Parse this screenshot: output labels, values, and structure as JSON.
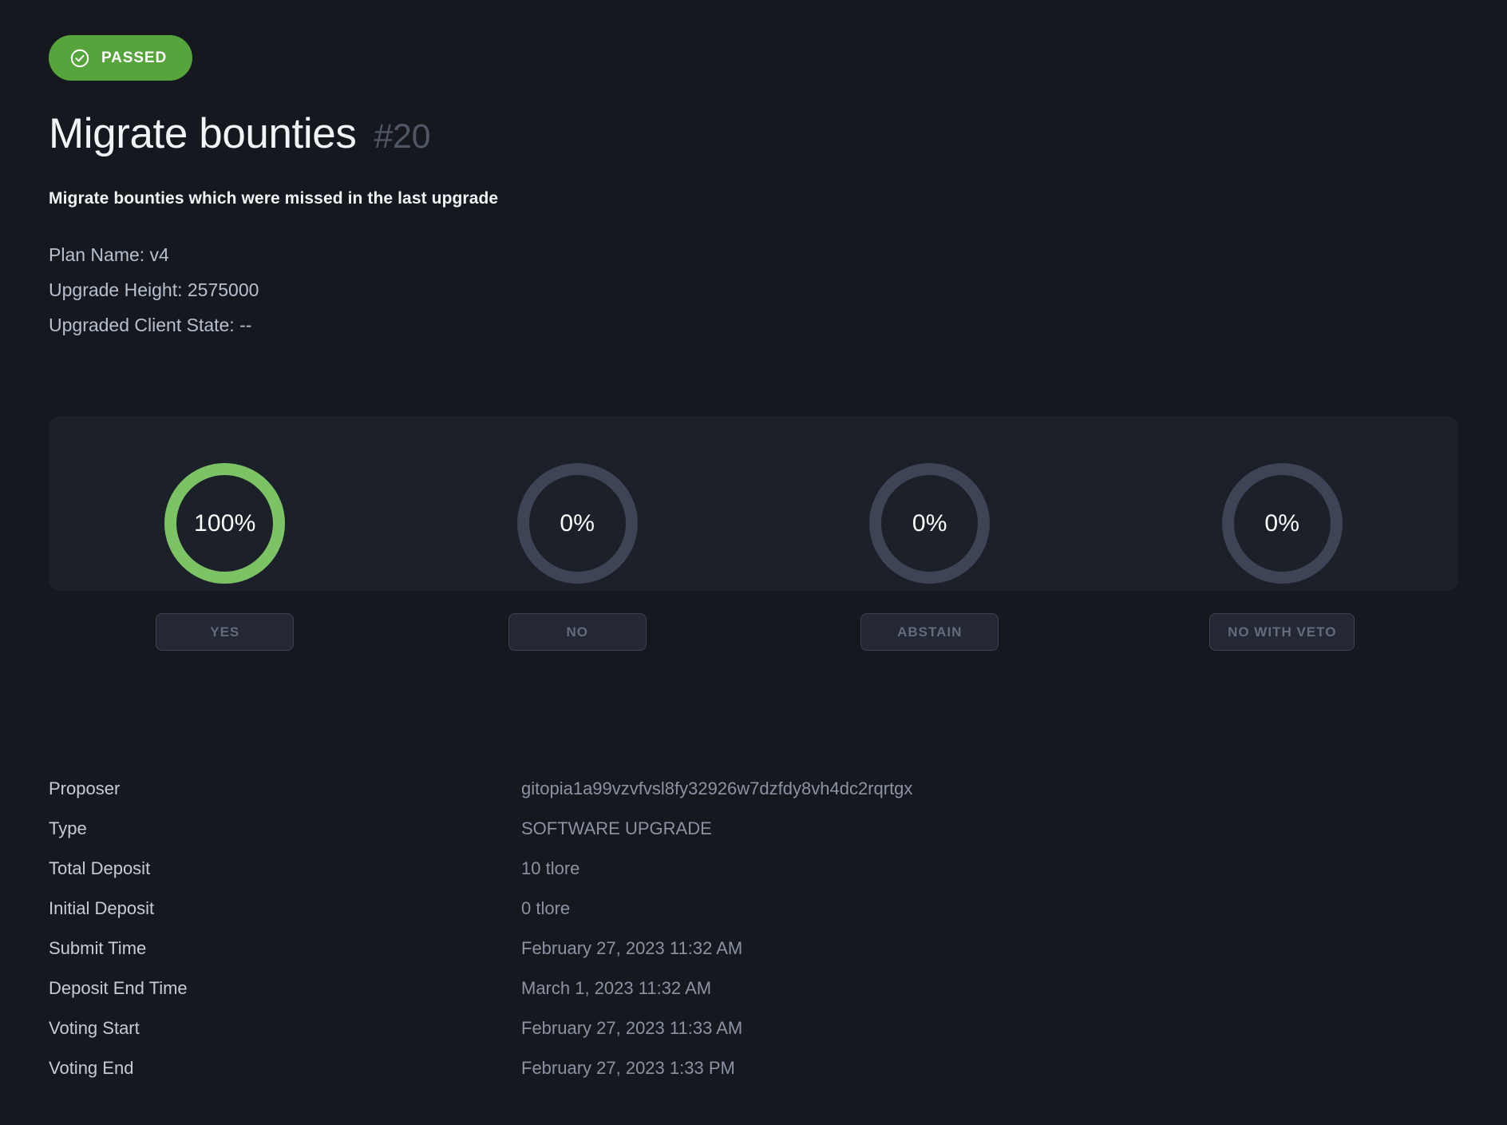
{
  "status": {
    "label": "PASSED",
    "icon": "check-circle-icon",
    "color": "#55a53c"
  },
  "header": {
    "title": "Migrate bounties",
    "number": "#20",
    "summary": "Migrate bounties which were missed in the last upgrade"
  },
  "plan": {
    "lines": [
      "Plan Name: v4",
      "Upgrade Height: 2575000",
      "Upgraded Client State: --"
    ]
  },
  "tally": {
    "options": [
      {
        "percent_label": "100%",
        "percent": 100,
        "button_label": "YES",
        "color": "#7cc365"
      },
      {
        "percent_label": "0%",
        "percent": 0,
        "button_label": "NO",
        "color": "#3e4355"
      },
      {
        "percent_label": "0%",
        "percent": 0,
        "button_label": "ABSTAIN",
        "color": "#3e4355"
      },
      {
        "percent_label": "0%",
        "percent": 0,
        "button_label": "NO WITH VETO",
        "color": "#3e4355"
      }
    ],
    "track_color": "#3e4355"
  },
  "details": [
    {
      "label": "Proposer",
      "value": "gitopia1a99vzvfvsl8fy32926w7dzfdy8vh4dc2rqrtgx"
    },
    {
      "label": "Type",
      "value": "SOFTWARE UPGRADE"
    },
    {
      "label": "Total Deposit",
      "value": "10 tlore"
    },
    {
      "label": "Initial Deposit",
      "value": "0 tlore"
    },
    {
      "label": "Submit Time",
      "value": "February 27, 2023 11:32 AM"
    },
    {
      "label": "Deposit End Time",
      "value": "March 1, 2023 11:32 AM"
    },
    {
      "label": "Voting Start",
      "value": "February 27, 2023 11:33 AM"
    },
    {
      "label": "Voting End",
      "value": "February 27, 2023 1:33 PM"
    }
  ]
}
